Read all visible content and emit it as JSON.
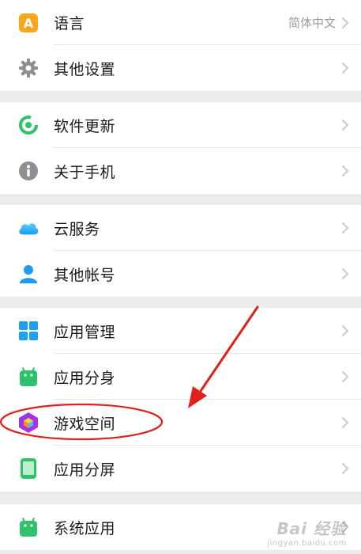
{
  "sections": [
    {
      "items": [
        {
          "name": "settings-item-language",
          "icon": "language-icon",
          "label": "语言",
          "value": "简体中文"
        },
        {
          "name": "settings-item-other-settings",
          "icon": "gear-icon",
          "label": "其他设置",
          "value": ""
        }
      ]
    },
    {
      "items": [
        {
          "name": "settings-item-software-update",
          "icon": "update-icon",
          "label": "软件更新",
          "value": ""
        },
        {
          "name": "settings-item-about-phone",
          "icon": "info-icon",
          "label": "关于手机",
          "value": ""
        }
      ]
    },
    {
      "items": [
        {
          "name": "settings-item-cloud-service",
          "icon": "cloud-icon",
          "label": "云服务",
          "value": ""
        },
        {
          "name": "settings-item-other-accounts",
          "icon": "person-icon",
          "label": "其他帐号",
          "value": ""
        }
      ]
    },
    {
      "items": [
        {
          "name": "settings-item-app-management",
          "icon": "app-grid-icon",
          "label": "应用管理",
          "value": ""
        },
        {
          "name": "settings-item-app-clone",
          "icon": "android-icon",
          "label": "应用分身",
          "value": ""
        },
        {
          "name": "settings-item-game-space",
          "icon": "game-cube-icon",
          "label": "游戏空间",
          "value": ""
        },
        {
          "name": "settings-item-split-screen",
          "icon": "phone-icon",
          "label": "应用分屏",
          "value": ""
        }
      ]
    },
    {
      "items": [
        {
          "name": "settings-item-system-apps",
          "icon": "android-icon",
          "label": "系统应用",
          "value": ""
        }
      ]
    }
  ],
  "annotation": {
    "arrow_color": "#e0201b",
    "highlight_target": "游戏空间"
  },
  "watermark": {
    "main": "Bai 经验",
    "sub": "jingyan.baidu.com"
  },
  "colors": {
    "background": "#ebebeb",
    "row_background": "#ffffff",
    "text": "#1a1a1a",
    "secondary_text": "#9a9a9a",
    "chevron": "#c4c4c4"
  }
}
